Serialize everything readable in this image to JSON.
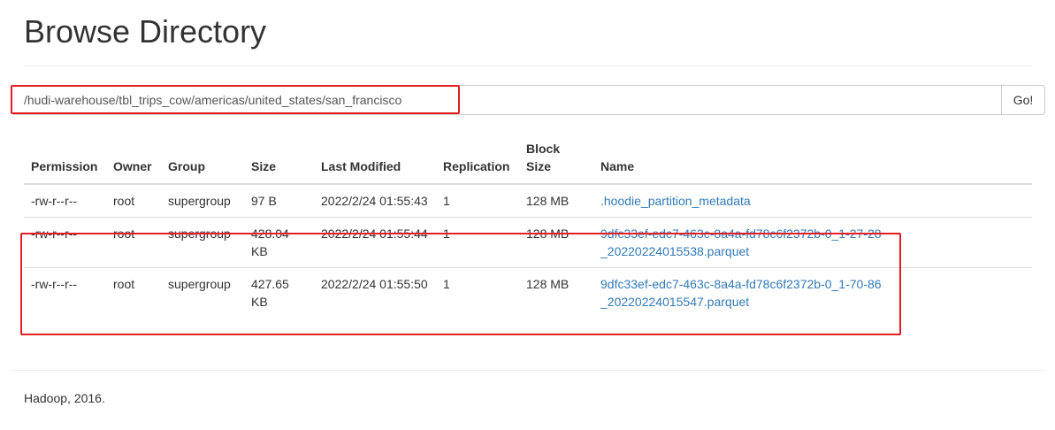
{
  "page": {
    "title": "Browse Directory"
  },
  "path_bar": {
    "path_value": "/hudi-warehouse/tbl_trips_cow/americas/united_states/san_francisco",
    "go_label": "Go!"
  },
  "table": {
    "headers": {
      "permission": "Permission",
      "owner": "Owner",
      "group": "Group",
      "size": "Size",
      "last_modified": "Last Modified",
      "replication": "Replication",
      "block_size": "Block Size",
      "name": "Name"
    },
    "rows": [
      {
        "permission": "-rw-r--r--",
        "owner": "root",
        "group": "supergroup",
        "size": "97 B",
        "last_modified": "2022/2/24 01:55:43",
        "replication": "1",
        "block_size": "128 MB",
        "name": ".hoodie_partition_metadata"
      },
      {
        "permission": "-rw-r--r--",
        "owner": "root",
        "group": "supergroup",
        "size": "428.04 KB",
        "last_modified": "2022/2/24 01:55:44",
        "replication": "1",
        "block_size": "128 MB",
        "name": "9dfc33ef-edc7-463c-8a4a-fd78c6f2372b-0_1-27-28_20220224015538.parquet"
      },
      {
        "permission": "-rw-r--r--",
        "owner": "root",
        "group": "supergroup",
        "size": "427.65 KB",
        "last_modified": "2022/2/24 01:55:50",
        "replication": "1",
        "block_size": "128 MB",
        "name": "9dfc33ef-edc7-463c-8a4a-fd78c6f2372b-0_1-70-86_20220224015547.parquet"
      }
    ]
  },
  "footer": {
    "text": "Hadoop, 2016."
  },
  "colors": {
    "link": "#337ab7",
    "highlight": "#e31e24",
    "border": "#dddddd"
  }
}
